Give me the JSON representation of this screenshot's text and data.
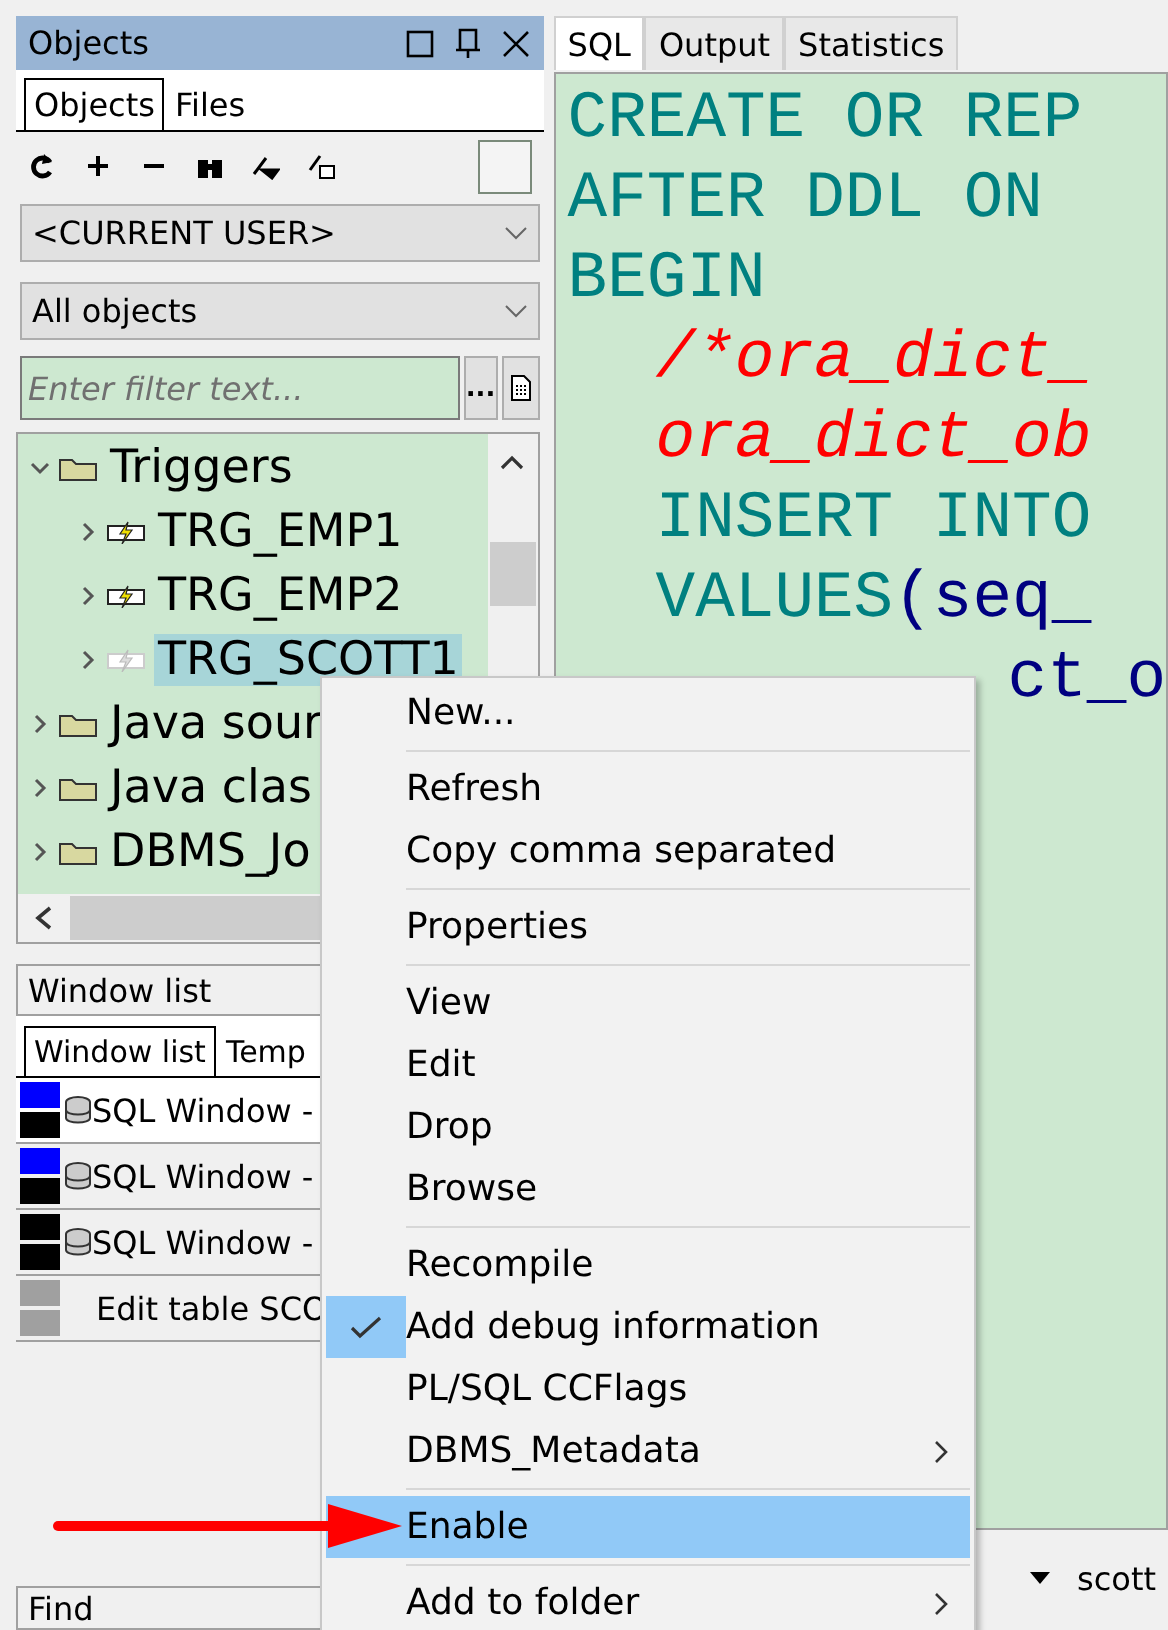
{
  "objects_panel": {
    "title": "Objects",
    "tabs": [
      {
        "label": "Objects",
        "selected": true
      },
      {
        "label": "Files",
        "selected": false
      }
    ],
    "user_select": {
      "value": "<CURRENT USER>"
    },
    "type_select": {
      "value": "All objects"
    },
    "filter": {
      "placeholder": "Enter filter text...",
      "button": "..."
    },
    "tree": [
      {
        "label": "Triggers",
        "kind": "folder",
        "expanded": true,
        "selected": false,
        "children": [
          {
            "label": "TRG_EMP1",
            "kind": "trigger",
            "enabled": true,
            "selected": false
          },
          {
            "label": "TRG_EMP2",
            "kind": "trigger",
            "enabled": true,
            "selected": false
          },
          {
            "label": "TRG_SCOTT1",
            "kind": "trigger",
            "enabled": false,
            "selected": true
          }
        ]
      },
      {
        "label": "Java sour",
        "kind": "folder",
        "expanded": false,
        "selected": false
      },
      {
        "label": "Java clas",
        "kind": "folder",
        "expanded": false,
        "selected": false
      },
      {
        "label": "DBMS_Jo",
        "kind": "folder",
        "expanded": false,
        "selected": false
      }
    ]
  },
  "window_list": {
    "title": "Window list",
    "tabs": [
      {
        "label": "Window list",
        "selected": true
      },
      {
        "label": "Temp",
        "selected": false
      }
    ],
    "rows": [
      {
        "label": "SQL Window -",
        "kind": "sql",
        "selected": true,
        "swatches": [
          {
            "color": "#0000ff"
          },
          {
            "color": "#000000"
          }
        ]
      },
      {
        "label": "SQL Window -",
        "kind": "sql",
        "selected": false,
        "swatches": [
          {
            "color": "#0000ff"
          },
          {
            "color": "#000000"
          }
        ]
      },
      {
        "label": "SQL Window -",
        "kind": "sql",
        "selected": false,
        "swatches": [
          {
            "color": "#000000"
          },
          {
            "color": "#000000"
          }
        ]
      },
      {
        "label": "Edit table SCO",
        "kind": "table",
        "selected": false,
        "swatches": [
          {
            "color": "#a0a0a0"
          },
          {
            "color": "#a0a0a0"
          }
        ]
      }
    ]
  },
  "find_panel": {
    "title": "Find"
  },
  "editor": {
    "tabs": [
      {
        "label": "SQL",
        "selected": true
      },
      {
        "label": "Output",
        "selected": false
      },
      {
        "label": "Statistics",
        "selected": false
      }
    ],
    "lines": [
      {
        "text": "CREATE OR REP",
        "kind": "keyword",
        "indent": false
      },
      {
        "text": "AFTER DDL ON",
        "kind": "keyword",
        "indent": false
      },
      {
        "text": "BEGIN",
        "kind": "keyword",
        "indent": false
      },
      {
        "text": "/*ora_dict_",
        "kind": "comment",
        "indent": true
      },
      {
        "text": "ora_dict_ob",
        "kind": "comment",
        "indent": true
      },
      {
        "text": "INSERT INTO",
        "kind": "keyword",
        "indent": true
      },
      {
        "text": "VALUES",
        "kind": "keyword",
        "indent": true,
        "rest": "(seq_"
      },
      {
        "text": "ct_o",
        "kind": "ident",
        "indent": true
      }
    ],
    "status_user": "scott"
  },
  "context_menu": [
    {
      "kind": "item",
      "label": "New...",
      "checked": false,
      "selected": false,
      "submenu": false
    },
    {
      "kind": "separator"
    },
    {
      "kind": "item",
      "label": "Refresh",
      "checked": false,
      "selected": false,
      "submenu": false
    },
    {
      "kind": "item",
      "label": "Copy comma separated",
      "checked": false,
      "selected": false,
      "submenu": false
    },
    {
      "kind": "separator"
    },
    {
      "kind": "item",
      "label": "Properties",
      "checked": false,
      "selected": false,
      "submenu": false
    },
    {
      "kind": "separator"
    },
    {
      "kind": "item",
      "label": "View",
      "checked": false,
      "selected": false,
      "submenu": false
    },
    {
      "kind": "item",
      "label": "Edit",
      "checked": false,
      "selected": false,
      "submenu": false
    },
    {
      "kind": "item",
      "label": "Drop",
      "checked": false,
      "selected": false,
      "submenu": false
    },
    {
      "kind": "item",
      "label": "Browse",
      "checked": false,
      "selected": false,
      "submenu": false
    },
    {
      "kind": "separator"
    },
    {
      "kind": "item",
      "label": "Recompile",
      "checked": false,
      "selected": false,
      "submenu": false
    },
    {
      "kind": "item",
      "label": "Add debug information",
      "checked": true,
      "selected": false,
      "submenu": false
    },
    {
      "kind": "item",
      "label": "PL/SQL CCFlags",
      "checked": false,
      "selected": false,
      "submenu": false
    },
    {
      "kind": "item",
      "label": "DBMS_Metadata",
      "checked": false,
      "selected": false,
      "submenu": true
    },
    {
      "kind": "separator"
    },
    {
      "kind": "item",
      "label": "Enable",
      "checked": false,
      "selected": true,
      "submenu": false
    },
    {
      "kind": "separator"
    },
    {
      "kind": "item",
      "label": "Add to folder",
      "checked": false,
      "selected": false,
      "submenu": true
    }
  ]
}
